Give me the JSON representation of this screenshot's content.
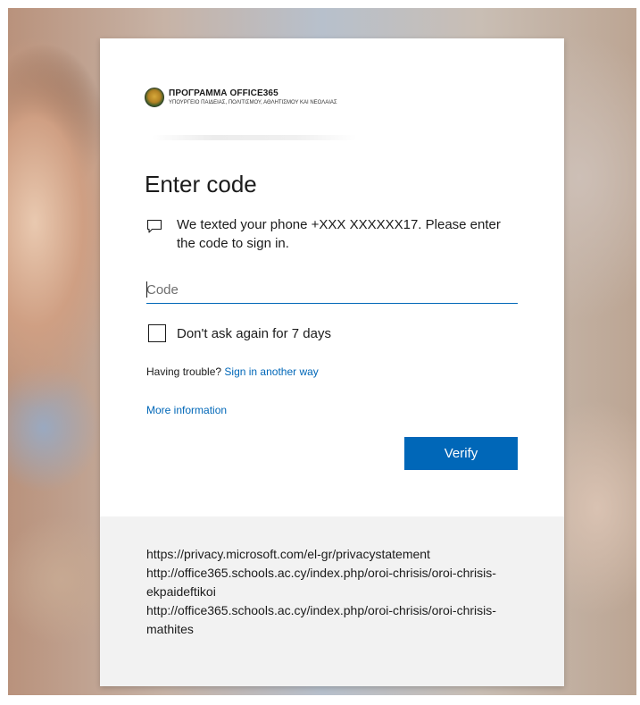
{
  "logo": {
    "title": "ΠΡΟΓΡΑΜΜΑ OFFICE365",
    "subtitle": "ΥΠΟΥΡΓΕΙΟ ΠΑΙΔΕΙΑΣ, ΠΟΛΙΤΙΣΜΟΥ, ΑΘΛΗΤΙΣΜΟΥ ΚΑΙ ΝΕΟΛΑΙΑΣ",
    "icon": "coat-of-arms-icon"
  },
  "page": {
    "title": "Enter code",
    "message": "We texted your phone +XXX XXXXXX17. Please enter the code to sign in.",
    "message_icon": "message-icon"
  },
  "code_input": {
    "placeholder": "Code",
    "value": ""
  },
  "remember": {
    "label": "Don't ask again for 7 days",
    "checked": false
  },
  "trouble": {
    "prefix": "Having trouble?",
    "link": "Sign in another way"
  },
  "more_info": {
    "label": "More information"
  },
  "verify": {
    "label": "Verify"
  },
  "footer": {
    "lines": [
      "https://privacy.microsoft.com/el-gr/privacystatement",
      "http://office365.schools.ac.cy/index.php/oroi-chrisis/oroi-chrisis-ekpaideftikoi",
      "http://office365.schools.ac.cy/index.php/oroi-chrisis/oroi-chrisis-mathites"
    ]
  },
  "colors": {
    "accent": "#0067b8",
    "text": "#1b1b1b",
    "footer_bg": "#f2f2f2"
  }
}
